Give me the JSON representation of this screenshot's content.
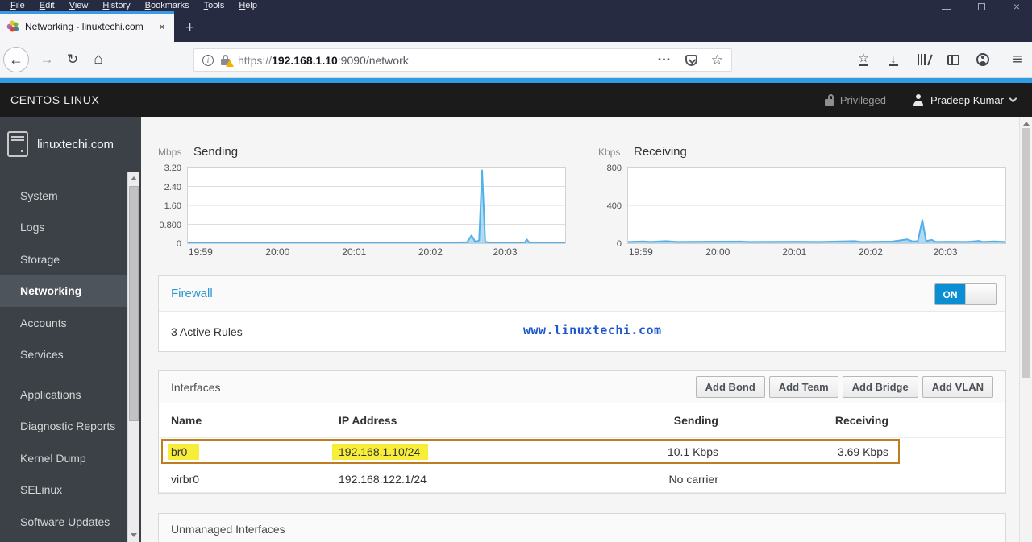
{
  "colors": {
    "accent_blue": "#2e9de4",
    "link_blue": "#2d97d3",
    "toggle_blue": "#0a8fd4",
    "chart_blue": "#54b0e8",
    "highlight_yellow": "#f7ee3a",
    "annotation_orange": "#bd7d21",
    "watermark_blue": "#1a56cc",
    "sidebar_bg": "#3b4147",
    "masthead_bg": "#1b1b1b"
  },
  "browser": {
    "menu_items": [
      "File",
      "Edit",
      "View",
      "History",
      "Bookmarks",
      "Tools",
      "Help"
    ],
    "tab_title": "Networking - linuxtechi.com",
    "url": {
      "scheme": "https://",
      "host": "192.168.1.10",
      "path": ":9090/network"
    },
    "icons": {
      "close_tab": "×",
      "new_tab": "+",
      "back": "←",
      "forward": "→",
      "reload": "↻",
      "home": "⌂",
      "info": "i",
      "dots": "•••",
      "bookmark_star": "☆",
      "save_star": "☆",
      "download_arrow": "↓",
      "hamburger": "≡",
      "close_window": "×"
    }
  },
  "masthead": {
    "brand": "CENTOS LINUX",
    "privileged_label": "Privileged",
    "user_name": "Pradeep Kumar"
  },
  "sidebar": {
    "hostname": "linuxtechi.com",
    "items": [
      {
        "label": "System",
        "selected": false
      },
      {
        "label": "Logs",
        "selected": false
      },
      {
        "label": "Storage",
        "selected": false
      },
      {
        "label": "Networking",
        "selected": true
      },
      {
        "label": "Accounts",
        "selected": false
      },
      {
        "label": "Services",
        "selected": false
      },
      {
        "label": "Applications",
        "selected": false
      },
      {
        "label": "Diagnostic Reports",
        "selected": false
      },
      {
        "label": "Kernel Dump",
        "selected": false
      },
      {
        "label": "SELinux",
        "selected": false
      },
      {
        "label": "Software Updates",
        "selected": false
      }
    ]
  },
  "firewall": {
    "title": "Firewall",
    "status_text": "3 Active Rules",
    "toggle_state": "ON",
    "watermark": "www.linuxtechi.com"
  },
  "interfaces": {
    "title": "Interfaces",
    "actions": [
      "Add Bond",
      "Add Team",
      "Add Bridge",
      "Add VLAN"
    ],
    "columns": [
      "Name",
      "IP Address",
      "Sending",
      "Receiving"
    ],
    "rows": [
      {
        "name": "br0",
        "ip": "192.168.1.10/24",
        "sending": "10.1 Kbps",
        "receiving": "3.69 Kbps",
        "highlighted": true
      },
      {
        "name": "virbr0",
        "ip": "192.168.122.1/24",
        "sending": "No carrier",
        "receiving": "",
        "highlighted": false
      }
    ]
  },
  "unmanaged": {
    "title": "Unmanaged Interfaces"
  },
  "chart_data": [
    {
      "type": "area",
      "title": "Sending",
      "unit": "Mbps",
      "ylim": [
        0,
        3.2
      ],
      "grid": true,
      "color": "#54b0e8",
      "yticks": [
        {
          "v": 0,
          "label": "0"
        },
        {
          "v": 0.8,
          "label": "0.800"
        },
        {
          "v": 1.6,
          "label": "1.60"
        },
        {
          "v": 2.4,
          "label": "2.40"
        },
        {
          "v": 3.2,
          "label": "3.20"
        }
      ],
      "xticks": [
        {
          "pos": 0.036,
          "label": "19:59"
        },
        {
          "pos": 0.24,
          "label": "20:00"
        },
        {
          "pos": 0.443,
          "label": "20:01"
        },
        {
          "pos": 0.645,
          "label": "20:02"
        },
        {
          "pos": 0.843,
          "label": "20:03"
        }
      ],
      "points": [
        [
          0,
          0.03
        ],
        [
          0.3,
          0.03
        ],
        [
          0.55,
          0.03
        ],
        [
          0.7,
          0.03
        ],
        [
          0.74,
          0.04
        ],
        [
          0.752,
          0.33
        ],
        [
          0.762,
          0.05
        ],
        [
          0.772,
          0.12
        ],
        [
          0.78,
          3.08
        ],
        [
          0.788,
          0.06
        ],
        [
          0.8,
          0.03
        ],
        [
          0.893,
          0.03
        ],
        [
          0.898,
          0.16
        ],
        [
          0.905,
          0.03
        ],
        [
          1,
          0.03
        ]
      ]
    },
    {
      "type": "area",
      "title": "Receiving",
      "unit": "Kbps",
      "ylim": [
        0,
        800
      ],
      "grid": true,
      "color": "#54b0e8",
      "yticks": [
        {
          "v": 0,
          "label": "0"
        },
        {
          "v": 400,
          "label": "400"
        },
        {
          "v": 800,
          "label": "800"
        }
      ],
      "xticks": [
        {
          "pos": 0.036,
          "label": "19:59"
        },
        {
          "pos": 0.24,
          "label": "20:00"
        },
        {
          "pos": 0.443,
          "label": "20:01"
        },
        {
          "pos": 0.645,
          "label": "20:02"
        },
        {
          "pos": 0.843,
          "label": "20:03"
        }
      ],
      "points": [
        [
          0,
          14
        ],
        [
          0.04,
          20
        ],
        [
          0.06,
          14
        ],
        [
          0.1,
          22
        ],
        [
          0.13,
          14
        ],
        [
          0.2,
          16
        ],
        [
          0.3,
          18
        ],
        [
          0.32,
          14
        ],
        [
          0.45,
          16
        ],
        [
          0.5,
          14
        ],
        [
          0.6,
          22
        ],
        [
          0.62,
          14
        ],
        [
          0.66,
          16
        ],
        [
          0.7,
          18
        ],
        [
          0.74,
          40
        ],
        [
          0.755,
          18
        ],
        [
          0.768,
          22
        ],
        [
          0.78,
          245
        ],
        [
          0.79,
          22
        ],
        [
          0.805,
          35
        ],
        [
          0.815,
          14
        ],
        [
          0.85,
          16
        ],
        [
          0.9,
          14
        ],
        [
          0.93,
          25
        ],
        [
          0.94,
          14
        ],
        [
          0.97,
          20
        ],
        [
          1,
          14
        ]
      ]
    }
  ]
}
